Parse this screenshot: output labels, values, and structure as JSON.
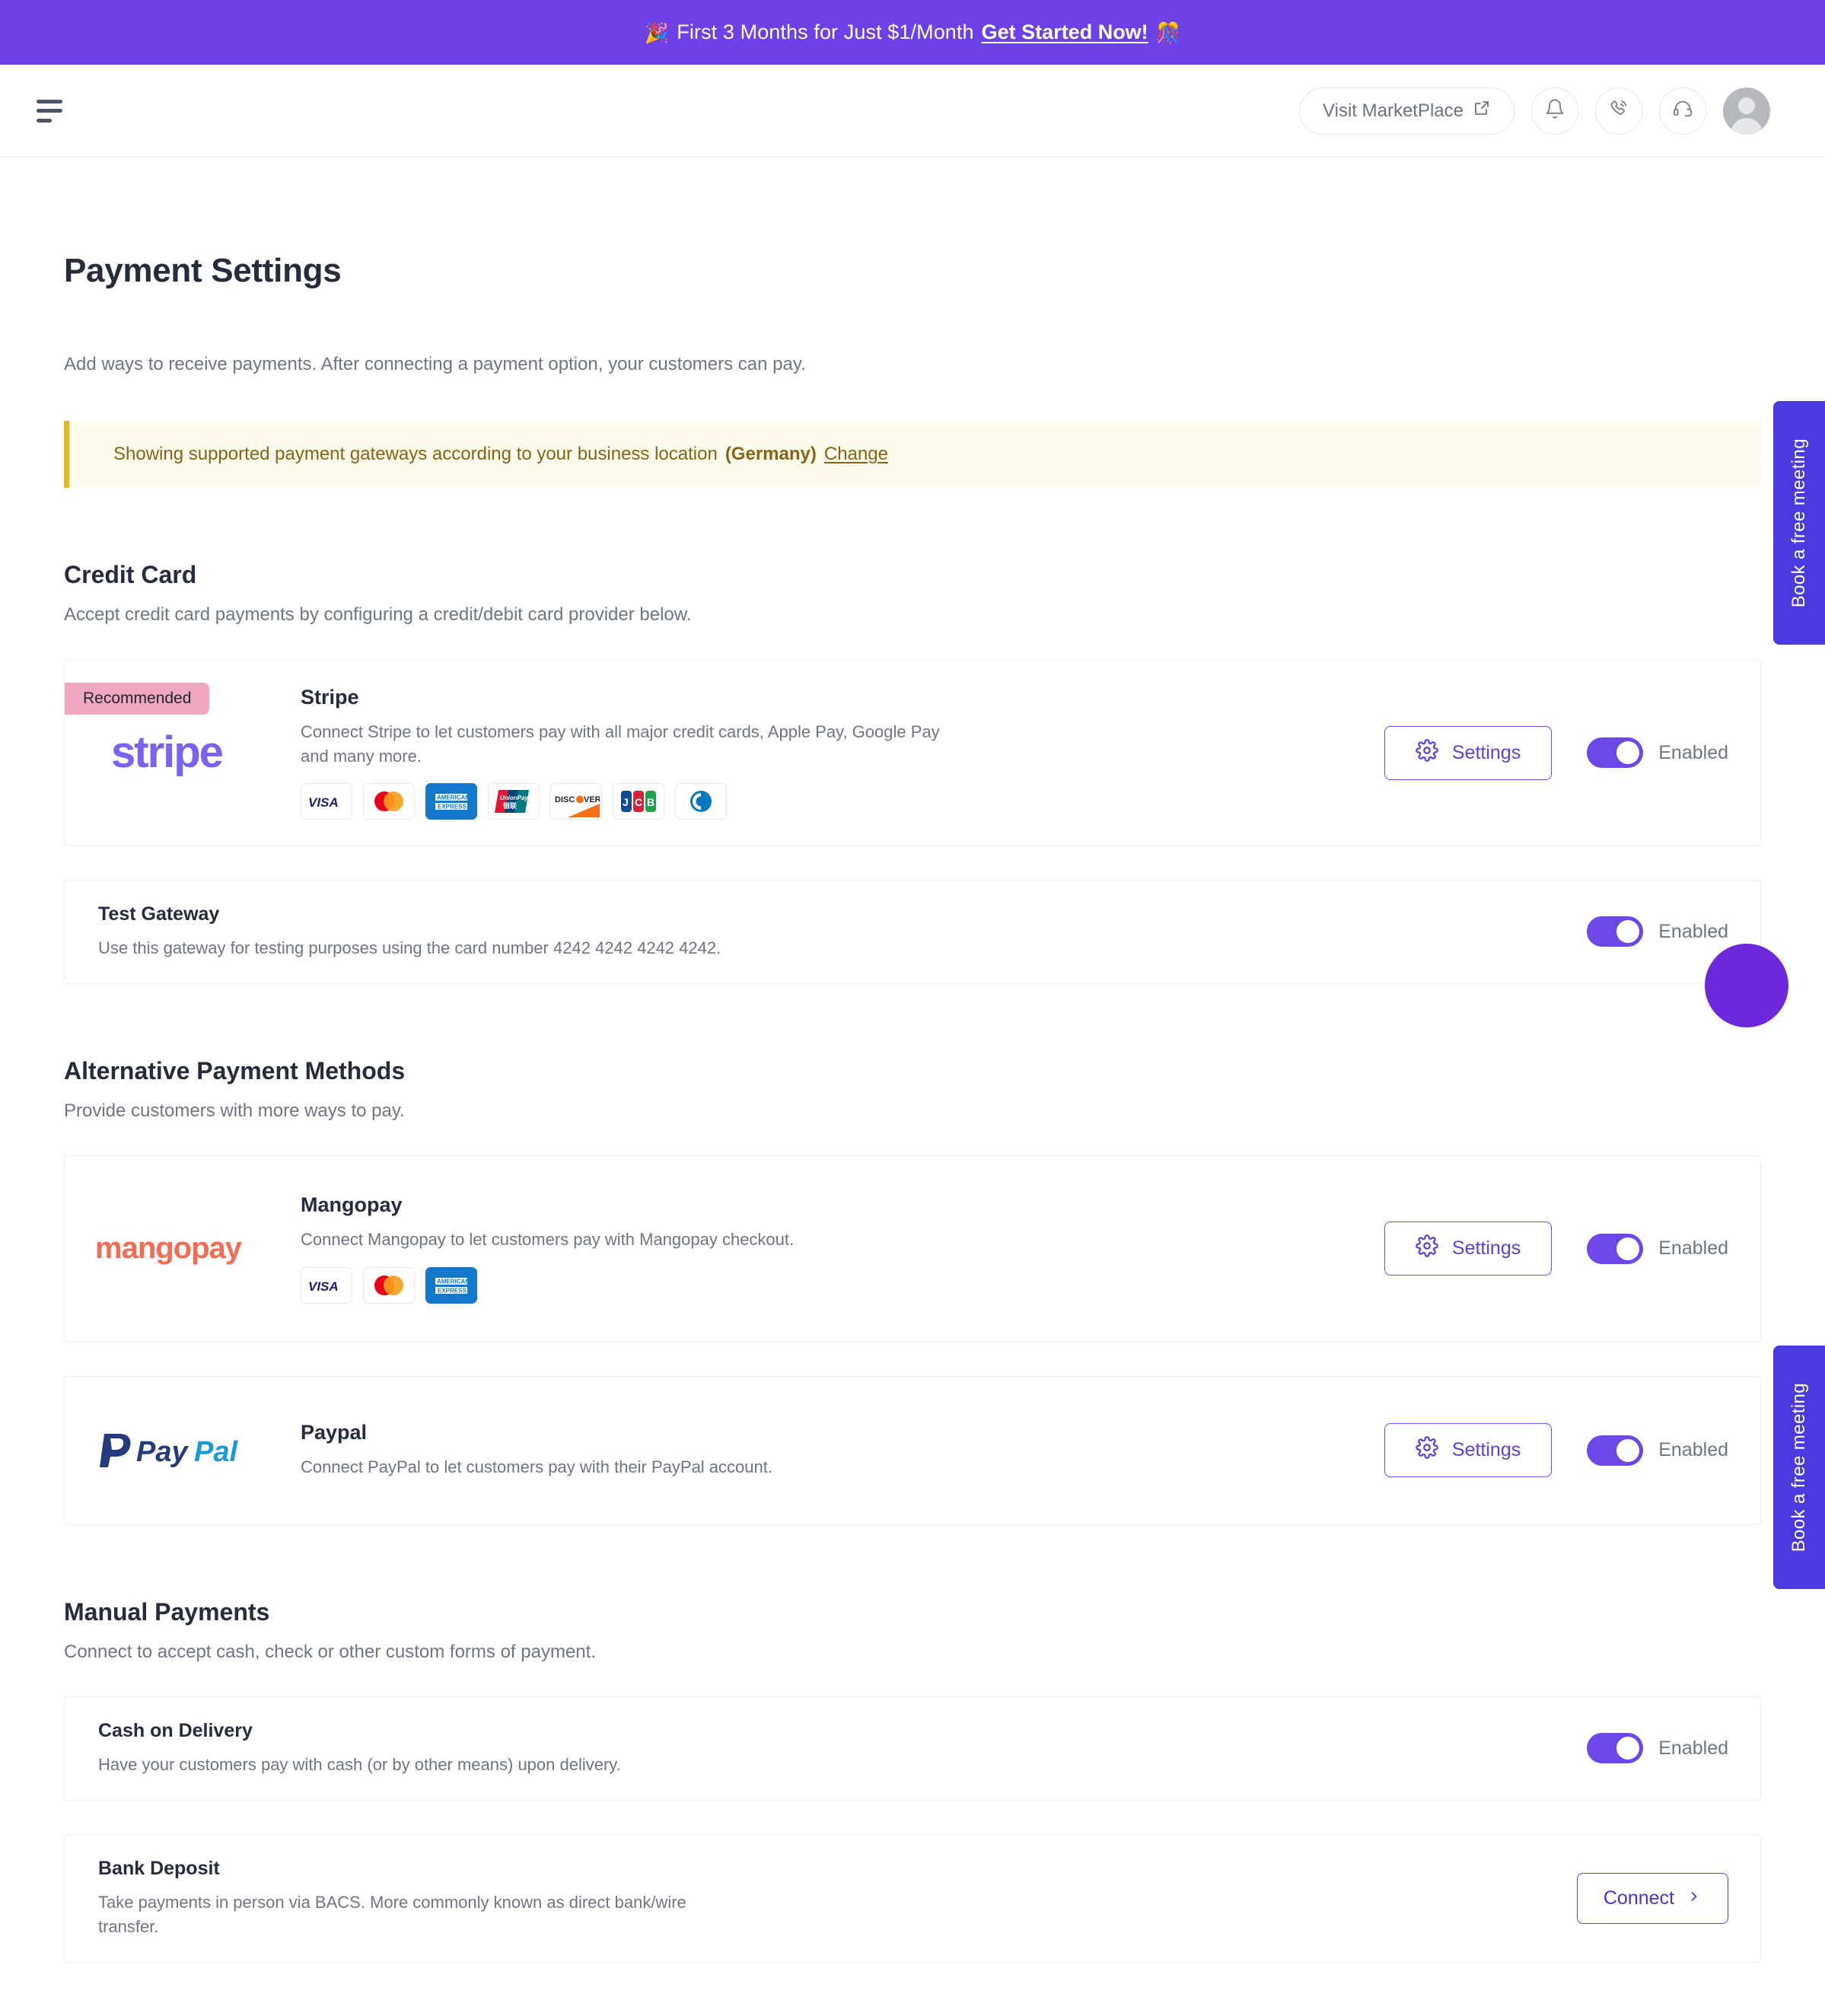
{
  "promo": {
    "emoji_left": "🎉",
    "text": "First 3 Months for Just $1/Month",
    "link": "Get Started Now!",
    "emoji_right": "🎊",
    "background": "#6E40E8"
  },
  "header": {
    "menu_icon": "hamburger-icon",
    "marketplace_label": "Visit MarketPlace",
    "icons": [
      "bell-icon",
      "phone-ring-icon",
      "headset-icon",
      "avatar"
    ]
  },
  "page": {
    "title": "Payment Settings",
    "subtitle": "Add ways to receive payments. After connecting a payment option, your customers can pay."
  },
  "notice": {
    "text": "Showing supported payment gateways according to your business location",
    "location": "(Germany)",
    "link": "Change",
    "accent": "#E5B91F",
    "background": "#FDFBEC"
  },
  "sections": [
    {
      "heading": "Credit Card",
      "description": "Accept credit card payments by configuring a credit/debit card provider below.",
      "gateways": [
        {
          "badge": "Recommended",
          "logo": "stripe-logo",
          "name": "Stripe",
          "description": "Connect Stripe to let customers pay with all major credit cards, Apple Pay, Google Pay and many more.",
          "brands": [
            "visa",
            "mastercard",
            "amex",
            "unionpay",
            "discover",
            "jcb",
            "diners"
          ],
          "settings_label": "Settings",
          "toggle_label": "Enabled",
          "toggle_on": true
        },
        {
          "logo": null,
          "name": "Test Gateway",
          "description": "Use this gateway for testing purposes using the card number 4242 4242 4242 4242.",
          "brands": [],
          "settings_label": null,
          "toggle_label": "Enabled",
          "toggle_on": true
        }
      ]
    },
    {
      "heading": "Alternative Payment Methods",
      "description": "Provide customers with more ways to pay.",
      "gateways": [
        {
          "logo": "mangopay-logo",
          "name": "Mangopay",
          "description": "Connect Mangopay to let customers pay with Mangopay checkout.",
          "brands": [
            "visa",
            "mastercard",
            "amex"
          ],
          "settings_label": "Settings",
          "toggle_label": "Enabled",
          "toggle_on": true
        },
        {
          "logo": "paypal-logo",
          "name": "Paypal",
          "description": "Connect PayPal to let customers pay with their PayPal account.",
          "brands": [],
          "settings_label": "Settings",
          "toggle_label": "Enabled",
          "toggle_on": true
        }
      ]
    },
    {
      "heading": "Manual Payments",
      "description": "Connect to accept cash, check or other custom forms of payment.",
      "gateways": [
        {
          "logo": null,
          "name": "Cash on Delivery",
          "description": "Have your customers pay with cash (or by other means) upon delivery.",
          "brands": [],
          "settings_label": null,
          "toggle_label": "Enabled",
          "toggle_on": true
        },
        {
          "logo": null,
          "name": "Bank Deposit",
          "description": "Take payments in person via BACS. More commonly known as direct bank/wire transfer.",
          "brands": [],
          "connect_label": "Connect",
          "toggle_label": null
        }
      ]
    }
  ],
  "side_tabs": [
    {
      "label": "Book a free meeting"
    },
    {
      "label": "Book a free meeting"
    }
  ],
  "chat_widget": {
    "name": "chat-bubble",
    "color": "#6E28DC"
  },
  "colors": {
    "brand_purple": "#6E40E8",
    "toggle_on": "#6E47E8",
    "badge_pink": "#EFA7C2",
    "text_dark": "#242C3E",
    "text_muted": "#6E7583"
  }
}
